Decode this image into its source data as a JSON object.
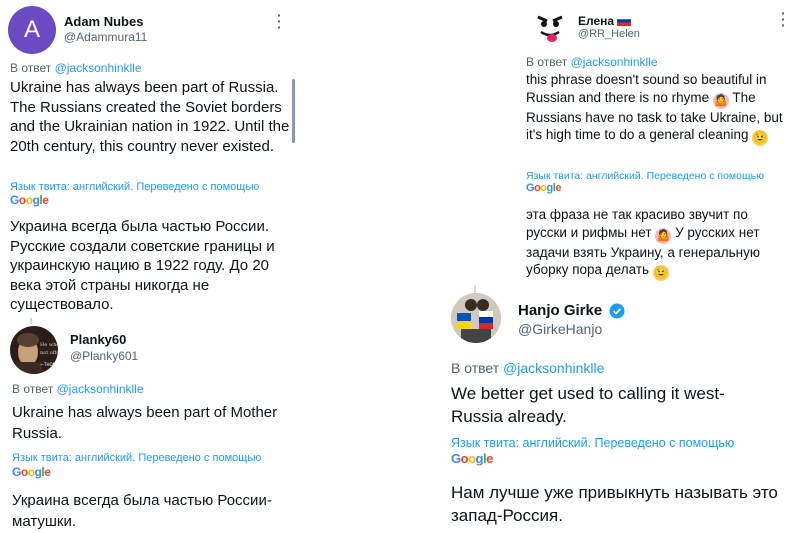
{
  "reply_prefix": "В ответ",
  "translated_note": "Язык твита: английский. Переведено с помощью",
  "google_logo": "Google",
  "tweets": [
    {
      "author": "Adam Nubes",
      "handle": "@Adammura11",
      "avatar_letter": "A",
      "reply_to": "@jacksonhinklle",
      "text": "Ukraine has always been part of Russia. The Russians created the Soviet borders and the Ukrainian nation in 1922. Until the 20th century, this country never existed.",
      "translation": "Украина всегда была частью России. Русские создали советские границы и украинскую нацию в 1922 году. До 20 века этой страны никогда не существовало."
    },
    {
      "author": "Planky60",
      "handle": "@Planky601",
      "reply_to": "@jacksonhinklle",
      "text": "Ukraine has always been part of Mother Russia.",
      "translation": "Украина всегда была частью России-матушки."
    },
    {
      "author": "Елена",
      "handle": "@RR_Helen",
      "reply_to": "@jacksonhinklle",
      "text_1": "this phrase doesn't sound so beautiful in Russian and there is no rhyme",
      "text_2": "The Russians have no task to take Ukraine, but it's high time to do a general cleaning",
      "translation_1": "эта фраза не так красиво звучит по русски и рифмы нет",
      "translation_2": "У русских нет задачи взять Украину, а генеральную уборку пора делать"
    },
    {
      "author": "Hanjo Girke",
      "handle": "@GirkeHanjo",
      "reply_to": "@jacksonhinklle",
      "text": "We better get used to calling it west-Russia already.",
      "translation": "Нам лучше уже привыкнуть называть это запад-Россия."
    }
  ],
  "colors": {
    "link": "#1d9bf0",
    "muted": "#536471",
    "avatar_purple": "#6a4bc4",
    "verified": "#1d9bf0"
  }
}
